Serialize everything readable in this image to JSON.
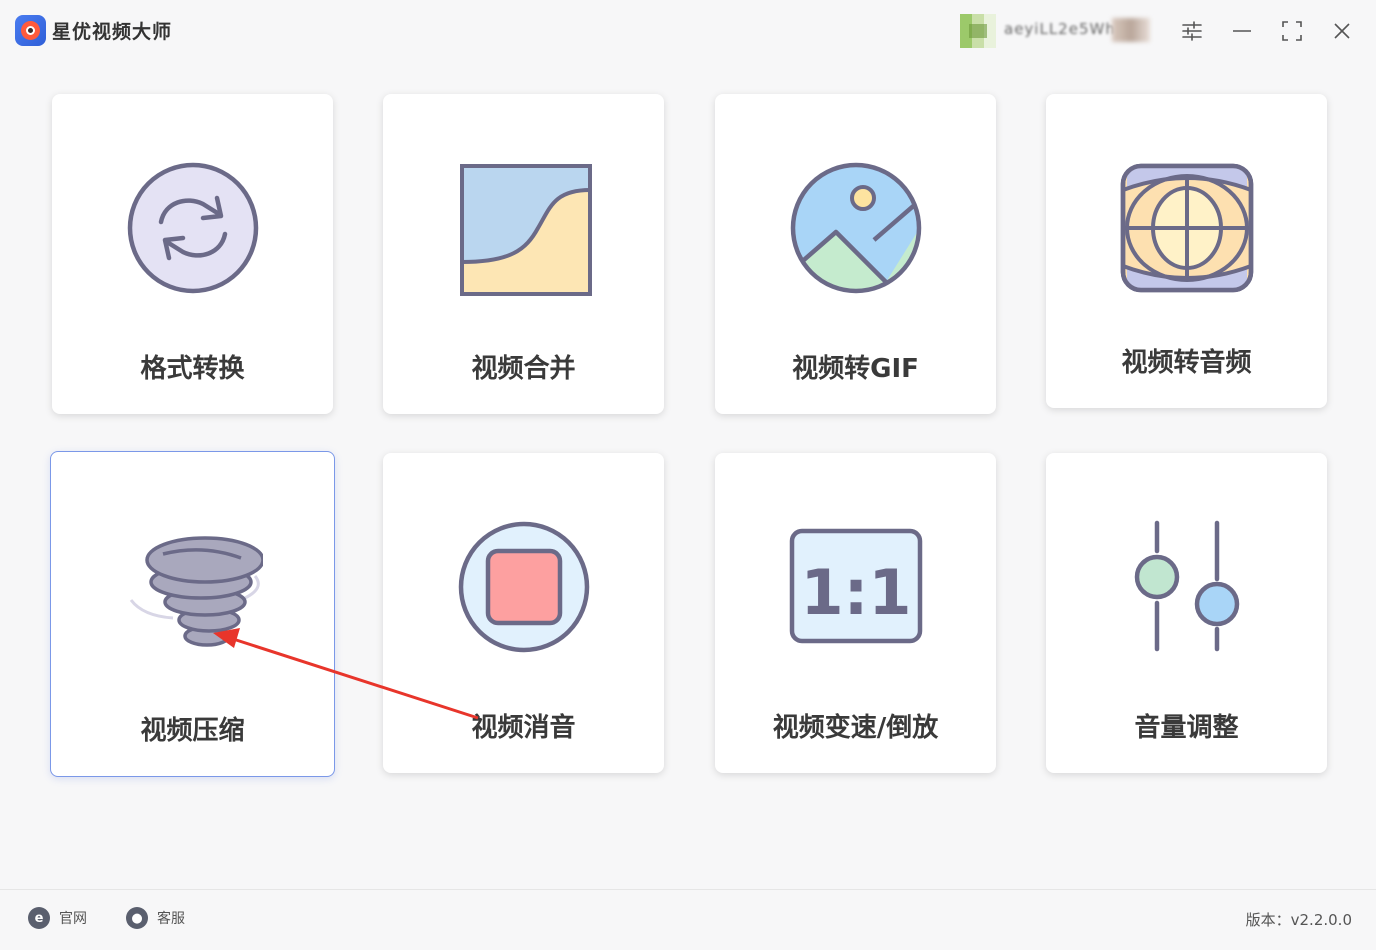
{
  "app": {
    "title": "星优视频大师"
  },
  "user": {
    "name": "aeyiLL2e5Wh"
  },
  "features": [
    {
      "label": "格式转换",
      "icon": "convert-icon"
    },
    {
      "label": "视频合并",
      "icon": "merge-icon"
    },
    {
      "label": "视频转GIF",
      "icon": "image-icon"
    },
    {
      "label": "视频转音频",
      "icon": "audio-globe-icon"
    },
    {
      "label": "视频压缩",
      "icon": "tornado-icon"
    },
    {
      "label": "视频消音",
      "icon": "stop-icon"
    },
    {
      "label": "视频变速/倒放",
      "icon": "ratio-icon",
      "icon_text": "1:1"
    },
    {
      "label": "音量调整",
      "icon": "sliders-icon"
    }
  ],
  "footer": {
    "website_label": "官网",
    "service_label": "客服",
    "version": "版本：v2.2.0.0"
  },
  "colors": {
    "accent": "#7b98e8",
    "arrow": "#e8352b"
  }
}
